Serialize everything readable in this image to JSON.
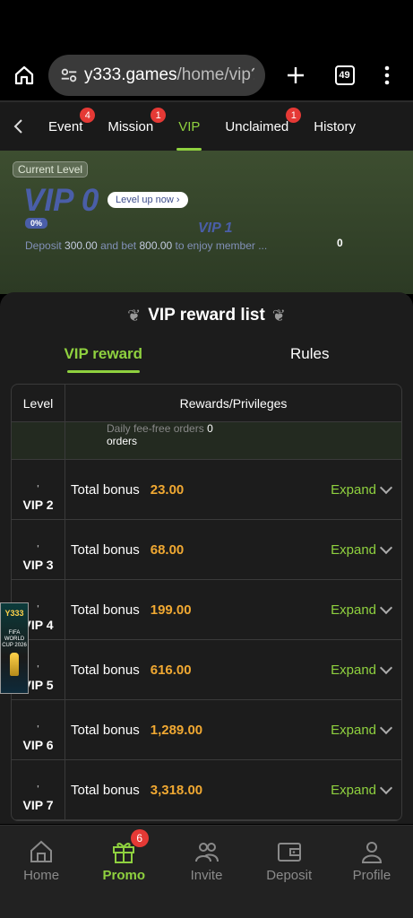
{
  "browser": {
    "url_host": "y333.games",
    "url_path": "/home/vip?d",
    "tab_count": "49"
  },
  "tabs": [
    {
      "label": "Event",
      "badge": "4"
    },
    {
      "label": "Mission",
      "badge": "1"
    },
    {
      "label": "VIP",
      "badge": ""
    },
    {
      "label": "Unclaimed",
      "badge": "1"
    },
    {
      "label": "History",
      "badge": ""
    }
  ],
  "hero": {
    "current_level_label": "Current Level",
    "level": "VIP 0",
    "level_up_button": "Level up now",
    "progress_pct": "0%",
    "next_level": "VIP 1",
    "deposit_prefix": "Deposit",
    "deposit_amount": "300.00",
    "bet_prefix": "and bet",
    "bet_amount": "800.00",
    "deposit_suffix": "to enjoy member ...",
    "right_value": "0"
  },
  "reward_list": {
    "title": "VIP reward list",
    "tabs": [
      "VIP reward",
      "Rules"
    ],
    "col_level": "Level",
    "col_rewards": "Rewards/Privileges",
    "daily_label": "Daily fee-free orders",
    "daily_value": "0",
    "daily_unit": "orders",
    "bonus_label": "Total bonus",
    "expand_label": "Expand",
    "rows": [
      {
        "level": "VIP 2",
        "bonus": "23.00"
      },
      {
        "level": "VIP 3",
        "bonus": "68.00"
      },
      {
        "level": "VIP 4",
        "bonus": "199.00"
      },
      {
        "level": "VIP 5",
        "bonus": "616.00"
      },
      {
        "level": "VIP 6",
        "bonus": "1,289.00"
      },
      {
        "level": "VIP 7",
        "bonus": "3,318.00"
      }
    ]
  },
  "banner": {
    "logo": "Y333",
    "text": "FIFA WORLD CUP 2026"
  },
  "bottom_nav": [
    {
      "label": "Home",
      "icon": "home-icon"
    },
    {
      "label": "Promo",
      "icon": "gift-icon",
      "badge": "6"
    },
    {
      "label": "Invite",
      "icon": "invite-icon"
    },
    {
      "label": "Deposit",
      "icon": "wallet-icon"
    },
    {
      "label": "Profile",
      "icon": "profile-icon"
    }
  ]
}
